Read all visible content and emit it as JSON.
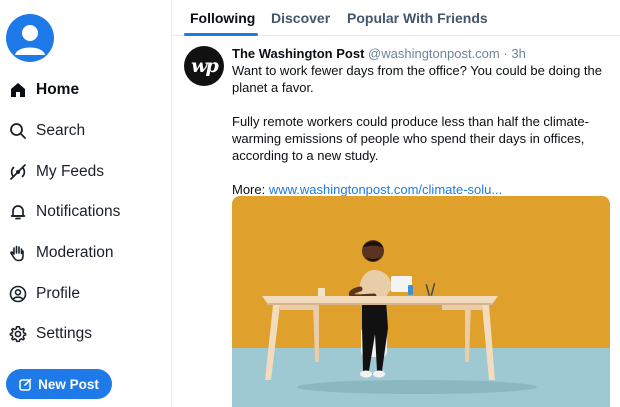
{
  "sidebar": {
    "items": [
      {
        "label": "Home",
        "icon": "home-icon"
      },
      {
        "label": "Search",
        "icon": "search-icon"
      },
      {
        "label": "My Feeds",
        "icon": "feeds-icon"
      },
      {
        "label": "Notifications",
        "icon": "bell-icon"
      },
      {
        "label": "Moderation",
        "icon": "hand-icon"
      },
      {
        "label": "Profile",
        "icon": "profile-icon"
      },
      {
        "label": "Settings",
        "icon": "gear-icon"
      }
    ],
    "new_post_label": "New Post"
  },
  "tabs": [
    {
      "label": "Following",
      "active": true
    },
    {
      "label": "Discover",
      "active": false
    },
    {
      "label": "Popular With Friends",
      "active": false
    }
  ],
  "post": {
    "avatar_text": "wp",
    "author": "The Washington Post",
    "handle": "@washingtonpost.com",
    "separator": "·",
    "time": "3h",
    "paragraph1": "Want to work fewer days from the office? You could be doing the planet a favor.",
    "paragraph2": "Fully remote workers could produce less than half the climate-warming emissions of people who spend their days in offices, according to a new study.",
    "more_label": "More:",
    "link_text": "www.washingtonpost.com/climate-solu..."
  },
  "colors": {
    "accent": "#1d7ae8",
    "image_top": "#e0a02c",
    "image_bottom": "#9fc9d2"
  }
}
